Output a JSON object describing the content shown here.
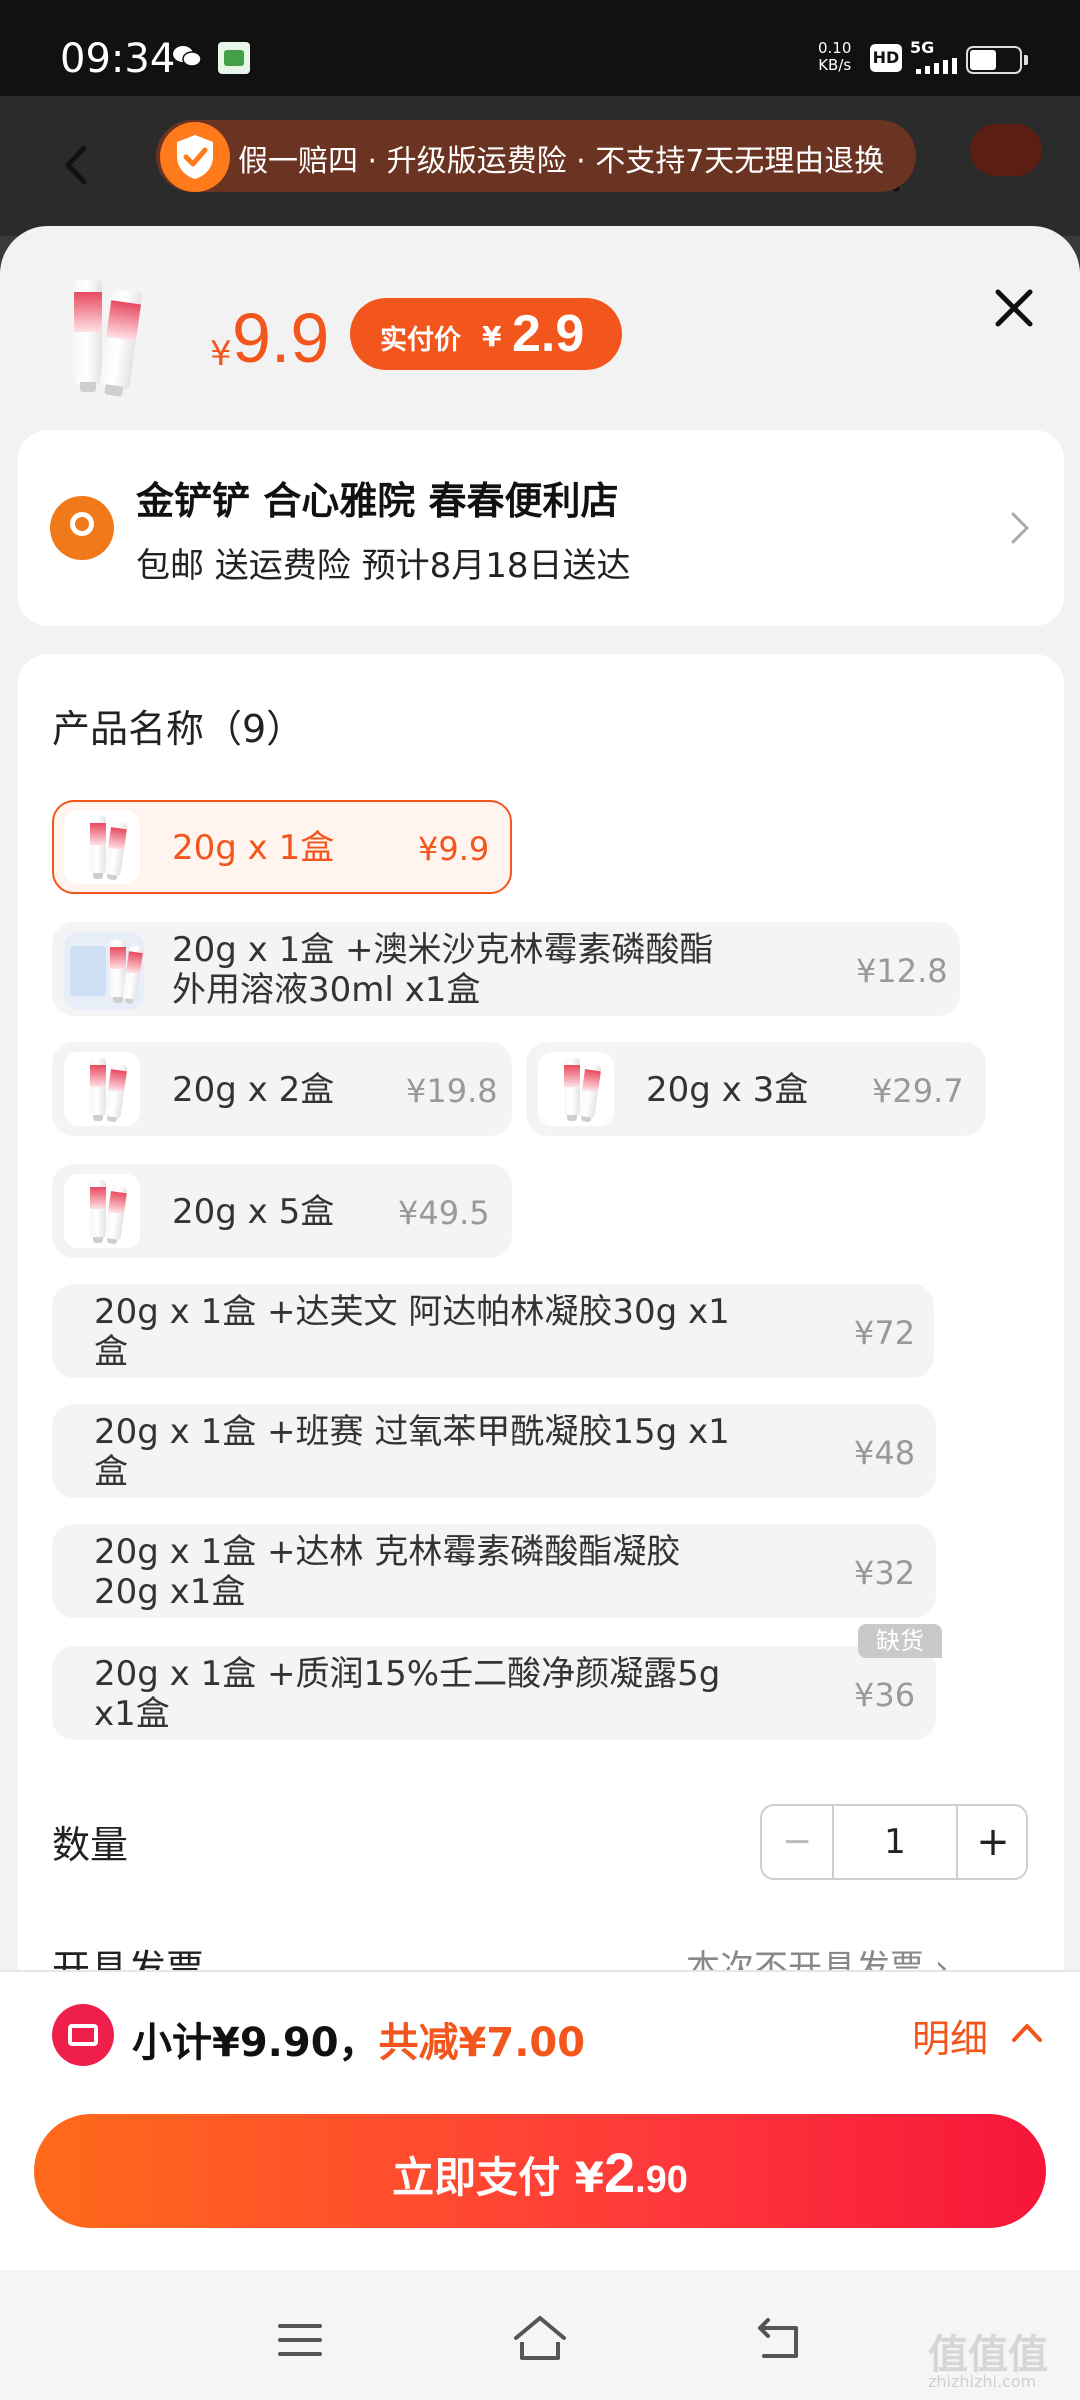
{
  "status_bar": {
    "time": "09:34",
    "net_speed_value": "0.10",
    "net_speed_unit": "KB/s",
    "hd": "HD",
    "network": "5G",
    "battery_percent": 45
  },
  "banner": {
    "text": "假一赔四 · 升级版运费险 · 不支持7天无理由退换"
  },
  "header": {
    "price_currency": "¥",
    "price": "9.9",
    "real_price_label": "实付价",
    "real_price_currency": "¥",
    "real_price": "2.9"
  },
  "address": {
    "name": "金铲铲 合心雅院 春春便利店",
    "subtitle": "包邮 送运费险 预计8月18日送达"
  },
  "options": {
    "title": "产品名称（9）",
    "items": [
      {
        "label": "20g x 1盒",
        "price": "¥9.9",
        "selected": true
      },
      {
        "label_line1": "20g x 1盒 +澳米沙克林霉素磷酸酯",
        "label_line2": "外用溶液30ml x1盒",
        "price": "¥12.8"
      },
      {
        "label": "20g x 2盒",
        "price": "¥19.8"
      },
      {
        "label": "20g x 3盒",
        "price": "¥29.7"
      },
      {
        "label": "20g x 5盒",
        "price": "¥49.5"
      },
      {
        "label_line1": "20g x 1盒 +达芙文 阿达帕林凝胶30g x1",
        "label_line2": "盒",
        "price": "¥72"
      },
      {
        "label_line1": "20g x 1盒 +班赛 过氧苯甲酰凝胶15g x1",
        "label_line2": "盒",
        "price": "¥48"
      },
      {
        "label_line1": "20g x 1盒 +达林 克林霉素磷酸酯凝胶",
        "label_line2": "20g x1盒",
        "price": "¥32"
      },
      {
        "label_line1": "20g x 1盒 +质润15%壬二酸净颜凝露5g",
        "label_line2": "x1盒",
        "price": "¥36",
        "badge": "缺货"
      }
    ]
  },
  "quantity": {
    "label": "数量",
    "minus": "−",
    "value": "1",
    "plus": "+"
  },
  "invoice": {
    "label": "开具发票",
    "value": "本次不开具发票 ›"
  },
  "footer": {
    "subtotal": "小计¥9.90，",
    "saving": "共减¥7.00",
    "detail": "明细",
    "pay_label": "立即支付 ¥",
    "pay_big": "2",
    "pay_small": ".90"
  },
  "navbar": {
    "watermark": "值值值",
    "watermark_sub": "zhizhizhi.com"
  },
  "colors": {
    "accent": "#f2561d",
    "pay_gradient_end": "#f6163b",
    "coupon": "#ee1f4b"
  }
}
